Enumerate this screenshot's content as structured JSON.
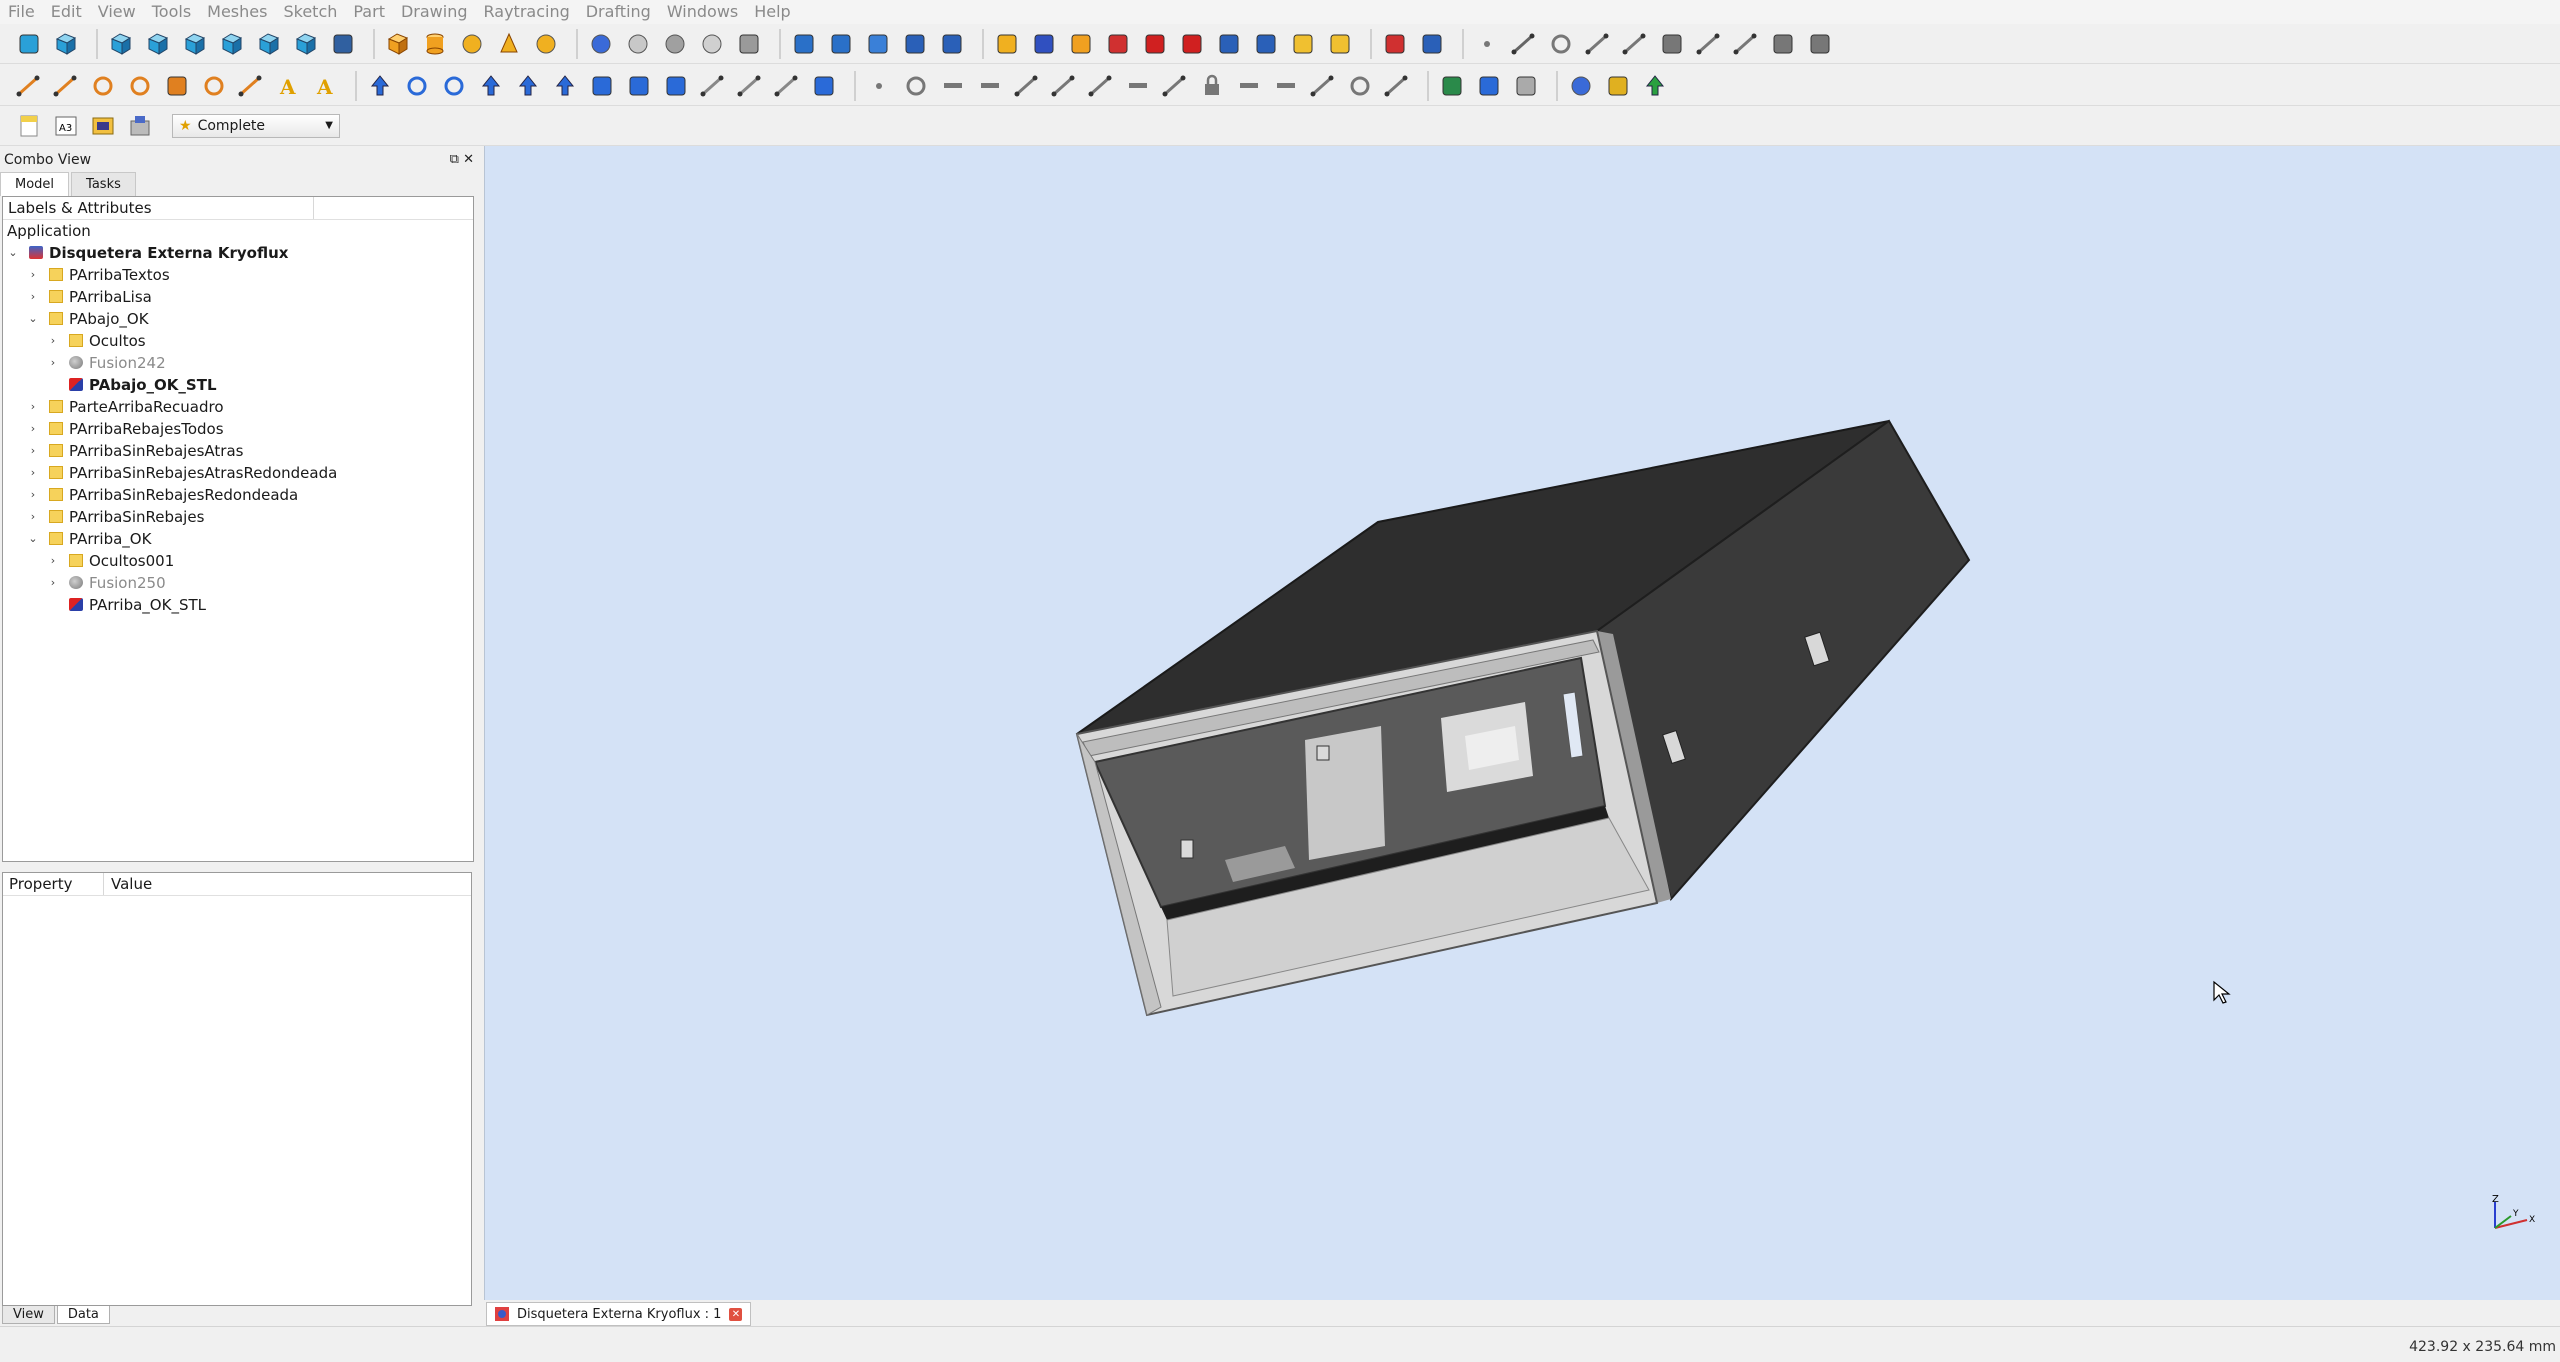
{
  "menu": [
    "File",
    "Edit",
    "View",
    "Tools",
    "Meshes",
    "Sketch",
    "Part",
    "Drawing",
    "Raytracing",
    "Drafting",
    "Windows",
    "Help"
  ],
  "toolbar": {
    "workbench": "Complete"
  },
  "combo_view": {
    "title": "Combo View",
    "tabs": [
      "Model",
      "Tasks"
    ]
  },
  "tree": {
    "header": "Labels & Attributes",
    "group": "Application",
    "items": [
      {
        "label": "Disquetera Externa Kryoflux",
        "level": 0,
        "icon": "document-icon",
        "expand": "open",
        "bold": true
      },
      {
        "label": "PArribaTextos",
        "level": 1,
        "icon": "folder-icon",
        "expand": "closed"
      },
      {
        "label": "PArribaLisa",
        "level": 1,
        "icon": "folder-icon",
        "expand": "closed"
      },
      {
        "label": "PAbajo_OK",
        "level": 1,
        "icon": "folder-icon",
        "expand": "open"
      },
      {
        "label": "Ocultos",
        "level": 2,
        "icon": "folder-icon",
        "expand": "closed"
      },
      {
        "label": "Fusion242",
        "level": 2,
        "icon": "fusion-icon",
        "expand": "closed",
        "grey": true
      },
      {
        "label": "PAbajo_OK_STL",
        "level": 2,
        "icon": "mesh-icon",
        "expand": "none",
        "bold": true
      },
      {
        "label": "ParteArribaRecuadro",
        "level": 1,
        "icon": "folder-icon",
        "expand": "closed"
      },
      {
        "label": "PArribaRebajesTodos",
        "level": 1,
        "icon": "folder-icon",
        "expand": "closed"
      },
      {
        "label": "PArribaSinRebajesAtras",
        "level": 1,
        "icon": "folder-icon",
        "expand": "closed"
      },
      {
        "label": "PArribaSinRebajesAtrasRedondeada",
        "level": 1,
        "icon": "folder-icon",
        "expand": "closed"
      },
      {
        "label": "PArribaSinRebajesRedondeada",
        "level": 1,
        "icon": "folder-icon",
        "expand": "closed"
      },
      {
        "label": "PArribaSinRebajes",
        "level": 1,
        "icon": "folder-icon",
        "expand": "closed"
      },
      {
        "label": "PArriba_OK",
        "level": 1,
        "icon": "folder-icon",
        "expand": "open"
      },
      {
        "label": "Ocultos001",
        "level": 2,
        "icon": "folder-icon",
        "expand": "closed"
      },
      {
        "label": "Fusion250",
        "level": 2,
        "icon": "fusion-icon",
        "expand": "closed",
        "grey": true
      },
      {
        "label": "PArriba_OK_STL",
        "level": 2,
        "icon": "mesh-icon",
        "expand": "none"
      }
    ]
  },
  "properties": {
    "col_property": "Property",
    "col_value": "Value"
  },
  "bottom_tabs": [
    "View",
    "Data"
  ],
  "document_tab": "Disquetera Externa Kryoflux : 1",
  "status": {
    "dimensions": "423.92 x 235.64 mm"
  },
  "axis_labels": {
    "z": "Z",
    "y": "Y",
    "x": "X"
  }
}
